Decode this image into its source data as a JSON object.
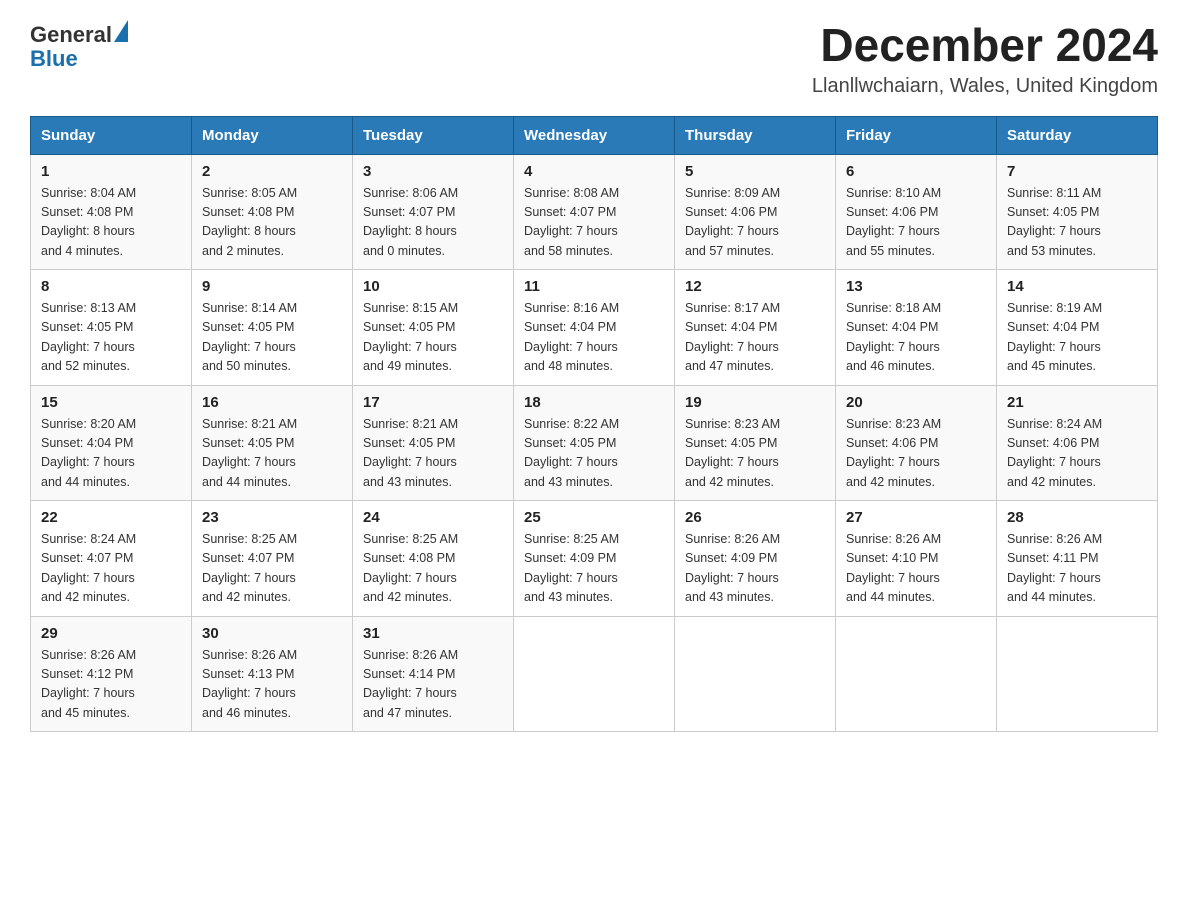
{
  "header": {
    "logo_general": "General",
    "logo_blue": "Blue",
    "month_title": "December 2024",
    "location": "Llanllwchaiarn, Wales, United Kingdom"
  },
  "columns": [
    "Sunday",
    "Monday",
    "Tuesday",
    "Wednesday",
    "Thursday",
    "Friday",
    "Saturday"
  ],
  "weeks": [
    [
      {
        "day": "1",
        "sunrise": "8:04 AM",
        "sunset": "4:08 PM",
        "daylight": "8 hours and 4 minutes."
      },
      {
        "day": "2",
        "sunrise": "8:05 AM",
        "sunset": "4:08 PM",
        "daylight": "8 hours and 2 minutes."
      },
      {
        "day": "3",
        "sunrise": "8:06 AM",
        "sunset": "4:07 PM",
        "daylight": "8 hours and 0 minutes."
      },
      {
        "day": "4",
        "sunrise": "8:08 AM",
        "sunset": "4:07 PM",
        "daylight": "7 hours and 58 minutes."
      },
      {
        "day": "5",
        "sunrise": "8:09 AM",
        "sunset": "4:06 PM",
        "daylight": "7 hours and 57 minutes."
      },
      {
        "day": "6",
        "sunrise": "8:10 AM",
        "sunset": "4:06 PM",
        "daylight": "7 hours and 55 minutes."
      },
      {
        "day": "7",
        "sunrise": "8:11 AM",
        "sunset": "4:05 PM",
        "daylight": "7 hours and 53 minutes."
      }
    ],
    [
      {
        "day": "8",
        "sunrise": "8:13 AM",
        "sunset": "4:05 PM",
        "daylight": "7 hours and 52 minutes."
      },
      {
        "day": "9",
        "sunrise": "8:14 AM",
        "sunset": "4:05 PM",
        "daylight": "7 hours and 50 minutes."
      },
      {
        "day": "10",
        "sunrise": "8:15 AM",
        "sunset": "4:05 PM",
        "daylight": "7 hours and 49 minutes."
      },
      {
        "day": "11",
        "sunrise": "8:16 AM",
        "sunset": "4:04 PM",
        "daylight": "7 hours and 48 minutes."
      },
      {
        "day": "12",
        "sunrise": "8:17 AM",
        "sunset": "4:04 PM",
        "daylight": "7 hours and 47 minutes."
      },
      {
        "day": "13",
        "sunrise": "8:18 AM",
        "sunset": "4:04 PM",
        "daylight": "7 hours and 46 minutes."
      },
      {
        "day": "14",
        "sunrise": "8:19 AM",
        "sunset": "4:04 PM",
        "daylight": "7 hours and 45 minutes."
      }
    ],
    [
      {
        "day": "15",
        "sunrise": "8:20 AM",
        "sunset": "4:04 PM",
        "daylight": "7 hours and 44 minutes."
      },
      {
        "day": "16",
        "sunrise": "8:21 AM",
        "sunset": "4:05 PM",
        "daylight": "7 hours and 44 minutes."
      },
      {
        "day": "17",
        "sunrise": "8:21 AM",
        "sunset": "4:05 PM",
        "daylight": "7 hours and 43 minutes."
      },
      {
        "day": "18",
        "sunrise": "8:22 AM",
        "sunset": "4:05 PM",
        "daylight": "7 hours and 43 minutes."
      },
      {
        "day": "19",
        "sunrise": "8:23 AM",
        "sunset": "4:05 PM",
        "daylight": "7 hours and 42 minutes."
      },
      {
        "day": "20",
        "sunrise": "8:23 AM",
        "sunset": "4:06 PM",
        "daylight": "7 hours and 42 minutes."
      },
      {
        "day": "21",
        "sunrise": "8:24 AM",
        "sunset": "4:06 PM",
        "daylight": "7 hours and 42 minutes."
      }
    ],
    [
      {
        "day": "22",
        "sunrise": "8:24 AM",
        "sunset": "4:07 PM",
        "daylight": "7 hours and 42 minutes."
      },
      {
        "day": "23",
        "sunrise": "8:25 AM",
        "sunset": "4:07 PM",
        "daylight": "7 hours and 42 minutes."
      },
      {
        "day": "24",
        "sunrise": "8:25 AM",
        "sunset": "4:08 PM",
        "daylight": "7 hours and 42 minutes."
      },
      {
        "day": "25",
        "sunrise": "8:25 AM",
        "sunset": "4:09 PM",
        "daylight": "7 hours and 43 minutes."
      },
      {
        "day": "26",
        "sunrise": "8:26 AM",
        "sunset": "4:09 PM",
        "daylight": "7 hours and 43 minutes."
      },
      {
        "day": "27",
        "sunrise": "8:26 AM",
        "sunset": "4:10 PM",
        "daylight": "7 hours and 44 minutes."
      },
      {
        "day": "28",
        "sunrise": "8:26 AM",
        "sunset": "4:11 PM",
        "daylight": "7 hours and 44 minutes."
      }
    ],
    [
      {
        "day": "29",
        "sunrise": "8:26 AM",
        "sunset": "4:12 PM",
        "daylight": "7 hours and 45 minutes."
      },
      {
        "day": "30",
        "sunrise": "8:26 AM",
        "sunset": "4:13 PM",
        "daylight": "7 hours and 46 minutes."
      },
      {
        "day": "31",
        "sunrise": "8:26 AM",
        "sunset": "4:14 PM",
        "daylight": "7 hours and 47 minutes."
      },
      null,
      null,
      null,
      null
    ]
  ],
  "labels": {
    "sunrise": "Sunrise:",
    "sunset": "Sunset:",
    "daylight": "Daylight:"
  }
}
